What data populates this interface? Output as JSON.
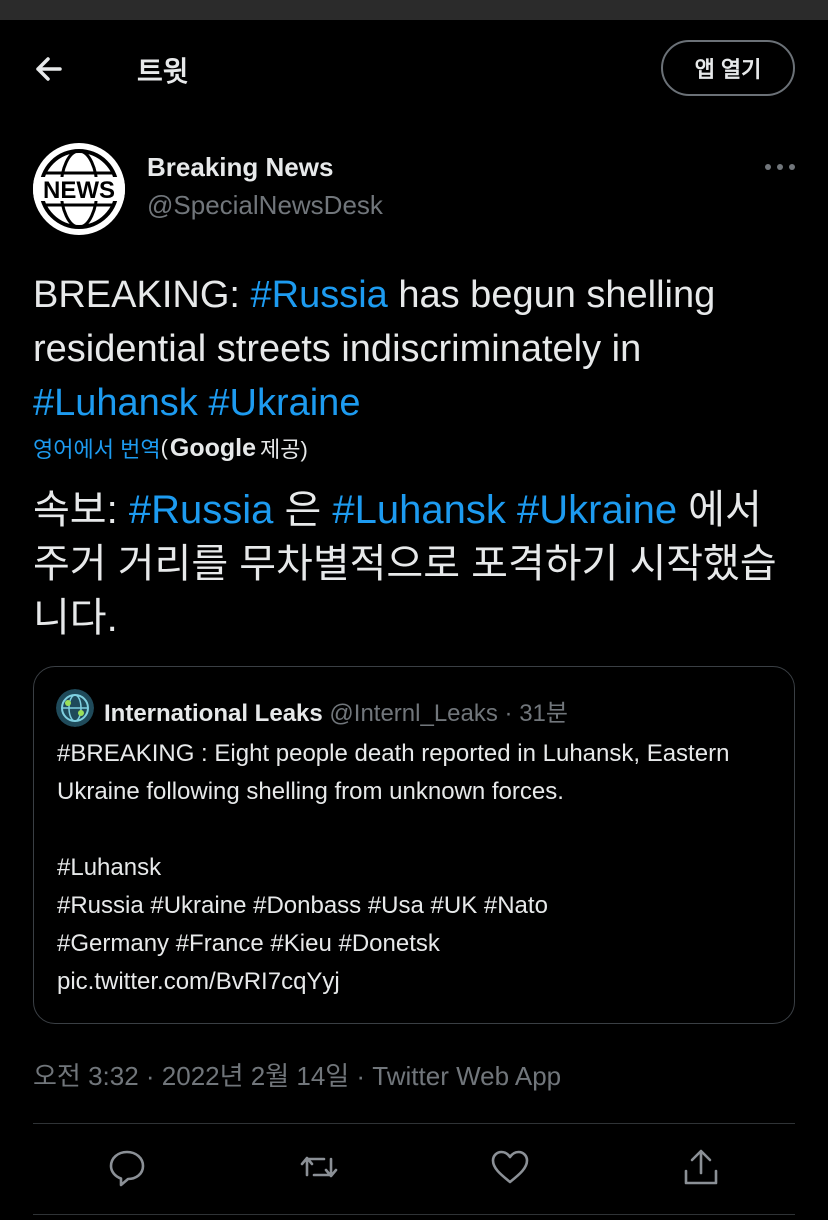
{
  "header": {
    "title": "트윗",
    "open_app_label": "앱 열기"
  },
  "author": {
    "name": "Breaking News",
    "handle": "@SpecialNewsDesk",
    "avatar_text": "NEWS"
  },
  "tweet": {
    "text_parts": [
      "BREAKING: ",
      "#Russia",
      " has begun shelling residential streets indiscriminately in ",
      "#Luhansk",
      " ",
      "#Ukraine"
    ],
    "translate_link": "영어에서 번역",
    "translate_paren_open": "(",
    "translate_brand": "Google",
    "translate_provider": "제공)",
    "translated_parts": [
      "속보: ",
      "#Russia",
      " 은 ",
      "#Luhansk",
      " ",
      "#Ukraine",
      " 에서 주거 거리를 무차별적으로 포격하기 시작했습니다."
    ]
  },
  "quote": {
    "name": "International Leaks",
    "handle_time": "@Internl_Leaks · 31분",
    "body": "#BREAKING : Eight people death reported in Luhansk, Eastern Ukraine following shelling from unknown forces.\n\n#Luhansk\n#Russia #Ukraine #Donbass #Usa #UK #Nato\n#Germany #France #Kieu #Donetsk\npic.twitter.com/BvRI7cqYyj"
  },
  "timestamp": "오전 3:32 · 2022년 2월 14일 · Twitter Web App",
  "actions": {
    "reply_icon": "reply-icon",
    "retweet_icon": "retweet-icon",
    "like_icon": "like-icon",
    "share_icon": "share-icon"
  },
  "colors": {
    "background": "#000000",
    "text": "#e7e9ea",
    "secondary": "#71767b",
    "link": "#1d9bf0"
  }
}
